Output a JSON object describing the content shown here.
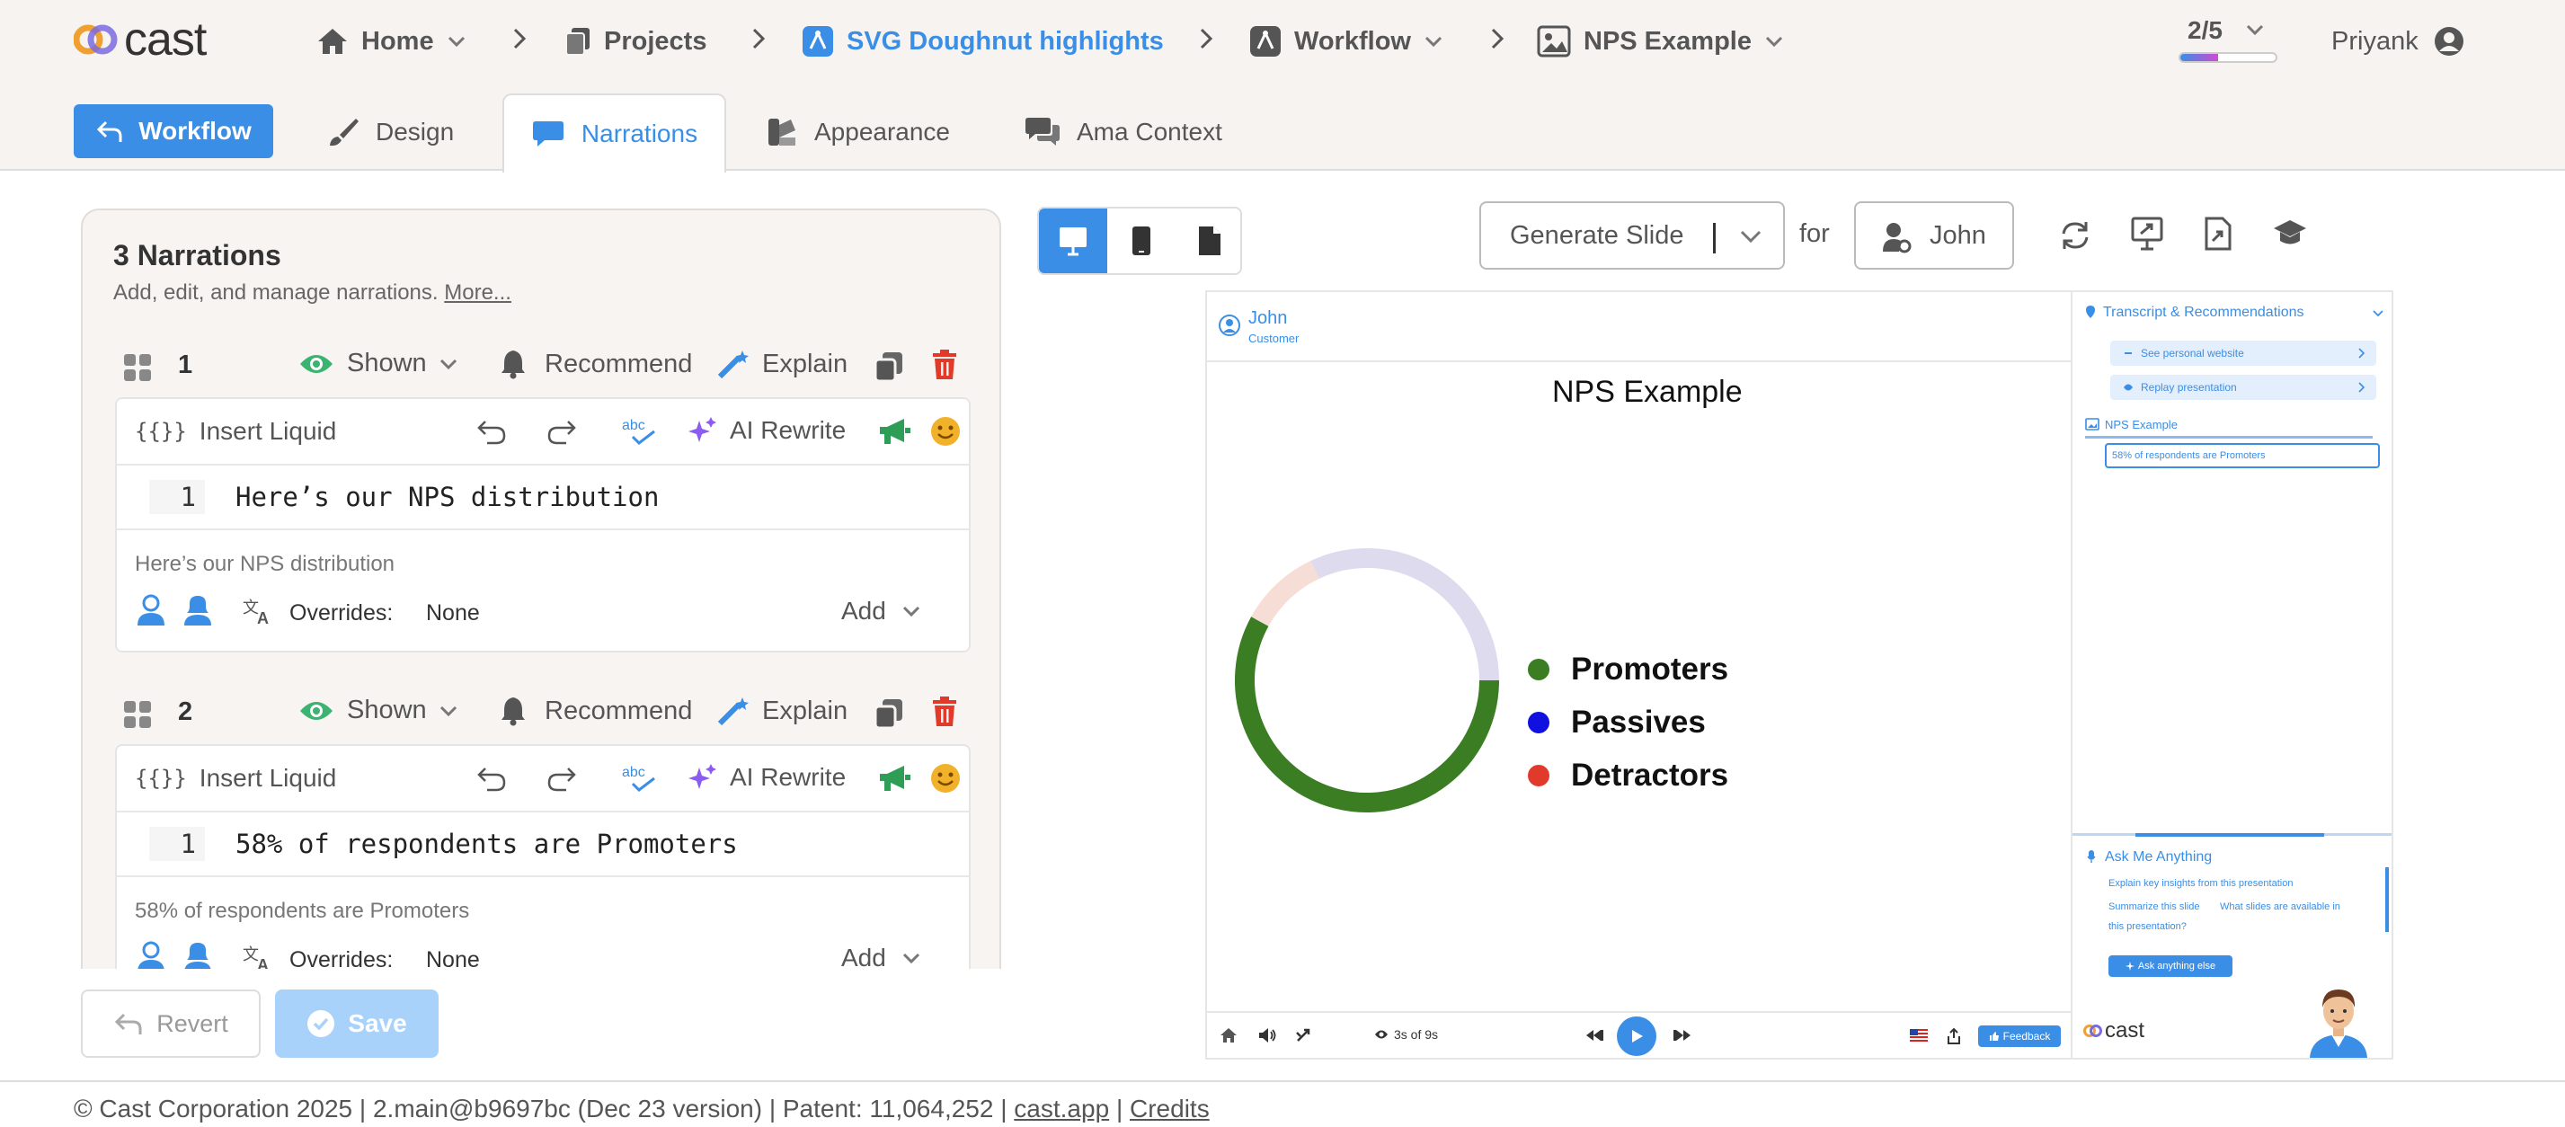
{
  "header": {
    "logo": "cast",
    "breadcrumbs": [
      {
        "label": "Home",
        "icon": "home-icon"
      },
      {
        "label": "Projects",
        "icon": "projects-icon"
      },
      {
        "label": "SVG Doughnut highlights",
        "icon": "project-icon"
      },
      {
        "label": "Workflow",
        "icon": "workflow-icon"
      },
      {
        "label": "NPS Example",
        "icon": "slide-icon"
      }
    ],
    "progress_label": "2/5",
    "progress_fraction": 0.4,
    "user_name": "Priyank"
  },
  "tabs": {
    "workflow_button": "Workflow",
    "items": [
      "Design",
      "Narrations",
      "Appearance",
      "Ama Context"
    ],
    "active": "Narrations"
  },
  "narrations": {
    "title": "3 Narrations",
    "subtitle": "Add, edit, and manage narrations.",
    "more_link": "More...",
    "shown_label": "Shown",
    "recommend_label": "Recommend",
    "explain_label": "Explain",
    "insert_liquid_label": "Insert Liquid",
    "ai_rewrite_label": "AI Rewrite",
    "overrides_label": "Overrides:",
    "overrides_value": "None",
    "add_label": "Add",
    "items": [
      {
        "number": "1",
        "line_no": "1",
        "code": "Here’s our NPS distribution",
        "preview": "Here’s our NPS distribution"
      },
      {
        "number": "2",
        "line_no": "1",
        "code": "58% of respondents are Promoters",
        "preview": "58% of respondents are Promoters"
      }
    ]
  },
  "actions": {
    "revert_label": "Revert",
    "save_label": "Save"
  },
  "toolbar_right": {
    "generate_label": "Generate Slide",
    "for_label": "for",
    "persona_label": "John"
  },
  "slide": {
    "user_name": "John",
    "user_role": "Customer",
    "title": "NPS Example",
    "legend": [
      {
        "label": "Promoters",
        "color": "#3a7d22"
      },
      {
        "label": "Passives",
        "color": "#1010e0"
      },
      {
        "label": "Detractors",
        "color": "#e23a2a"
      }
    ],
    "doughnut_segments": [
      {
        "label": "Promoters",
        "value": 58,
        "color": "#3a7d22"
      },
      {
        "label": "Detractors",
        "value": 10,
        "color": "#f6ddd6"
      },
      {
        "label": "Passives",
        "value": 32,
        "color": "#dedbef"
      }
    ],
    "player_time": "3s of 9s",
    "feedback_label": "Feedback",
    "brand": "cast"
  },
  "side_panel": {
    "title": "Transcript & Recommendations",
    "pills": [
      "See personal website",
      "Replay presentation"
    ],
    "section": "NPS Example",
    "narration_box": "58% of respondents are Promoters",
    "ama_title": "Ask Me Anything",
    "ama_line1": "Explain key insights from this presentation",
    "ama_line2a": "Summarize this slide",
    "ama_line2b": "What slides are available in",
    "ama_line3": "this presentation?",
    "ask_button": "Ask anything else"
  },
  "footer": {
    "copyright": "© Cast Corporation 2025 | 2.main@b9697bc (Dec 23 version) | Patent: 11,064,252 |",
    "link1": "cast.app",
    "sep": "|",
    "link2": "Credits"
  },
  "colors": {
    "accent": "#3a8ee6",
    "header_bg": "#f6f3f0",
    "delete_red": "#e23a2a",
    "eye_green": "#3cb371"
  }
}
